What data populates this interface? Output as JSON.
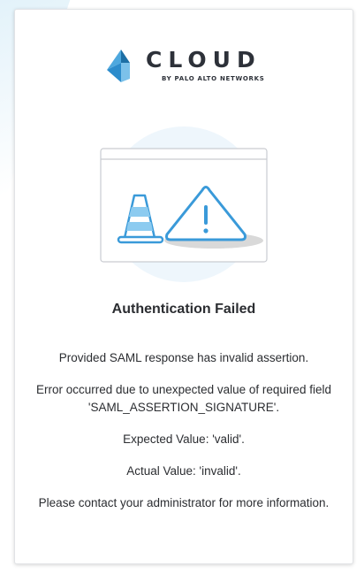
{
  "brand": {
    "name": "CLOUD",
    "tagline": "BY PALO ALTO NETWORKS",
    "accent_color": "#4ea8de"
  },
  "error": {
    "title": "Authentication Failed",
    "messages": [
      "Provided SAML response has invalid assertion.",
      "Error occurred due to unexpected value of required field 'SAML_ASSERTION_SIGNATURE'.",
      "Expected Value: 'valid'.",
      "Actual Value: 'invalid'.",
      "Please contact your administrator for more information."
    ]
  },
  "icons": {
    "logo": "cloud-logo-icon",
    "cone": "traffic-cone-icon",
    "warning": "warning-triangle-icon"
  }
}
